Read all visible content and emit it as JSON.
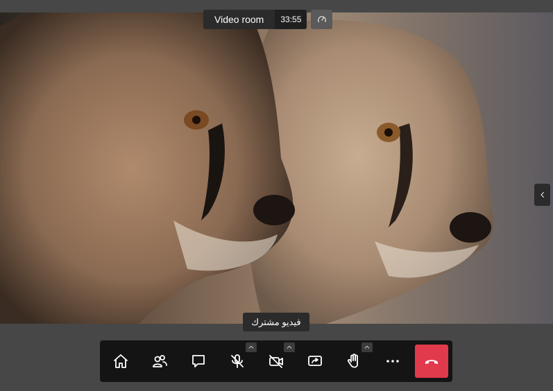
{
  "room": {
    "title": "Video room",
    "timer": "33:55"
  },
  "video": {
    "caption": "فيديو مشترك"
  },
  "toolbar": {
    "buttons": [
      {
        "name": "home",
        "icon": "home-icon"
      },
      {
        "name": "participants",
        "icon": "participants-icon"
      },
      {
        "name": "chat",
        "icon": "chat-icon"
      },
      {
        "name": "microphone",
        "icon": "mic-off-icon"
      },
      {
        "name": "camera",
        "icon": "camera-off-icon"
      },
      {
        "name": "share-screen",
        "icon": "screen-share-icon"
      },
      {
        "name": "raise-hand",
        "icon": "hand-icon"
      },
      {
        "name": "more",
        "icon": "more-icon"
      },
      {
        "name": "hangup",
        "icon": "phone-hangup-icon"
      }
    ]
  },
  "colors": {
    "hangup": "#e13a4c",
    "background": "#474747",
    "toolbar": "#141414"
  }
}
